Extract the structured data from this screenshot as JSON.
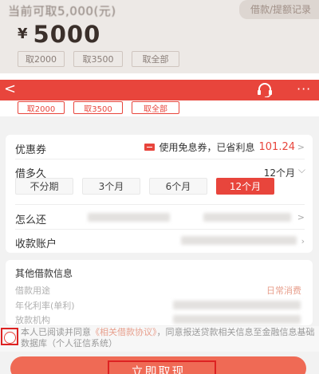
{
  "top": {
    "available_label": "当前可取5,000(元)",
    "record_link": "借款/提额记录",
    "currency": "¥",
    "amount": "5000",
    "chips": [
      "取2000",
      "取3500",
      "取全部"
    ]
  },
  "appbar": {
    "back_icon": "arrow-left",
    "service_icon": "headset",
    "more_icon": "ellipsis"
  },
  "amount_chips": [
    "取2000",
    "取3500",
    "取全部"
  ],
  "coupon": {
    "label": "优惠券",
    "text": "使用免息券，已省利息",
    "saved": "101.24"
  },
  "term": {
    "label": "借多久",
    "value": "12个月",
    "options": [
      "不分期",
      "3个月",
      "6个月",
      "12个月"
    ],
    "selected": "12个月"
  },
  "repay": {
    "label": "怎么还"
  },
  "account": {
    "label": "收款账户"
  },
  "other_info": {
    "title": "其他借款信息",
    "purpose_label": "借款用途",
    "purpose_value": "日常消费",
    "rate_label": "年化利率(单利)",
    "lender_label": "放款机构"
  },
  "agreement": {
    "prefix": "本人已阅读并同意",
    "link": "《相关借款协议》",
    "suffix": "，同意报送贷款相关信息至金融信息基础数据库（个人征信系统）"
  },
  "submit_label": "立即取现",
  "colors": {
    "accent": "#e8453c",
    "button": "#ef6a55",
    "highlight": "#dd2222"
  }
}
